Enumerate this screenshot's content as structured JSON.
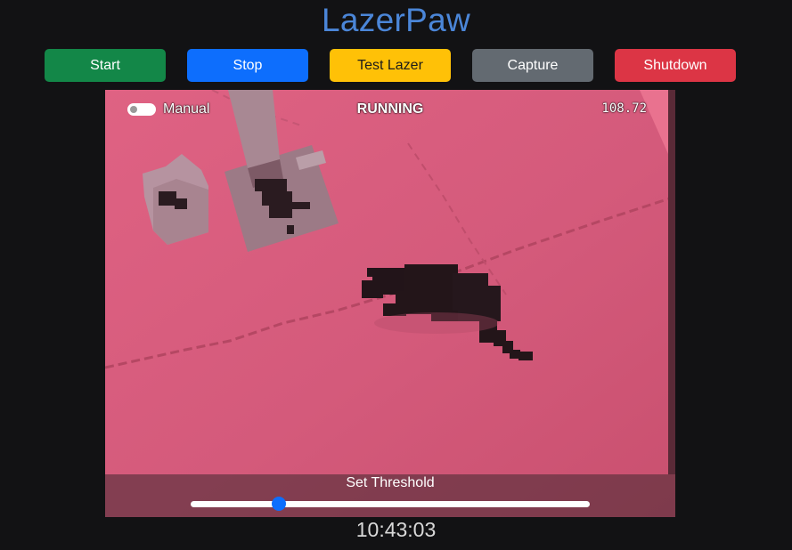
{
  "app": {
    "title": "LazerPaw"
  },
  "controls": {
    "buttons": [
      {
        "id": "start",
        "label": "Start",
        "color": "#138748"
      },
      {
        "id": "stop",
        "label": "Stop",
        "color": "#0d6efd"
      },
      {
        "id": "test_lazer",
        "label": "Test Lazer",
        "color": "#ffc107"
      },
      {
        "id": "capture",
        "label": "Capture",
        "color": "#636a71"
      },
      {
        "id": "shutdown",
        "label": "Shutdown",
        "color": "#dc3545"
      }
    ]
  },
  "video": {
    "manual_toggle": {
      "label": "Manual",
      "on": false
    },
    "status": "RUNNING",
    "fps_readout": "108.72",
    "threshold": {
      "label": "Set Threshold",
      "value_fraction": 0.22
    }
  },
  "footer": {
    "clock": "10:43:03"
  }
}
